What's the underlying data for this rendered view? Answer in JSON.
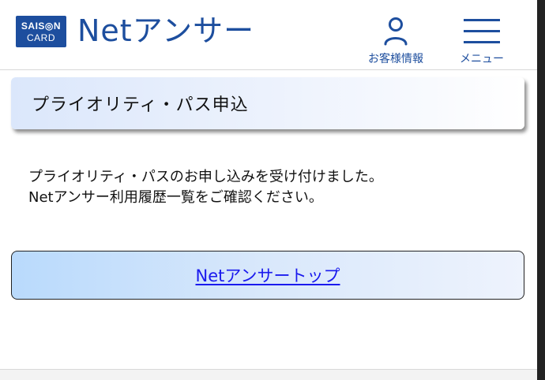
{
  "header": {
    "logo_line1": "SAIS◎N",
    "logo_line2": "CARD",
    "brand": "Netアンサー",
    "customer_label": "お客様情報",
    "menu_label": "メニュー"
  },
  "main": {
    "title": "プライオリティ・パス申込",
    "message_line1": "プライオリティ・パスのお申し込みを受け付けました。",
    "message_line2": "Netアンサー利用履歴一覧をご確認ください。",
    "top_link": "Netアンサートップ"
  },
  "colors": {
    "brand_blue": "#1d4e9e",
    "link_blue": "#1a1aee"
  },
  "icons": {
    "customer": "person-icon",
    "menu": "hamburger-icon"
  }
}
